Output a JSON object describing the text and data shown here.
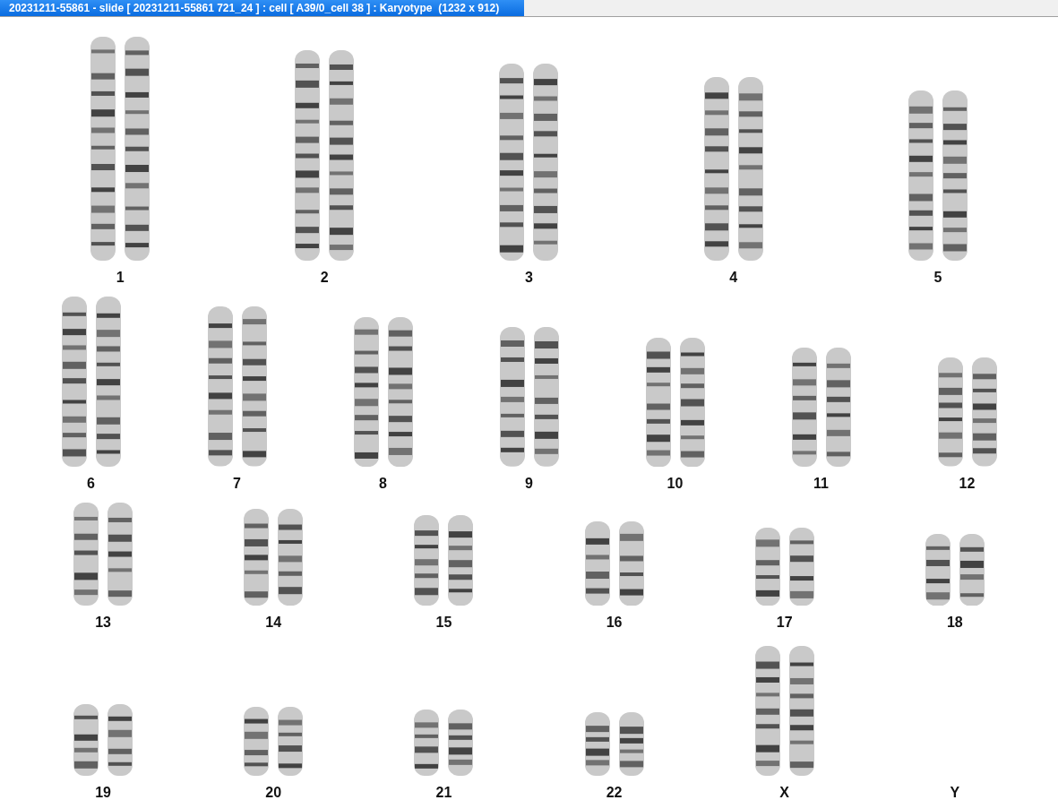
{
  "window": {
    "title": "20231211-55861 - slide [ 20231211-55861 721_24 ] : cell [ A39/0_cell 38 ] : Karyotype  (1232 x 912)"
  },
  "karyotype": {
    "rows": [
      {
        "groups": [
          {
            "label": "1",
            "kind": "pair"
          },
          {
            "label": "2",
            "kind": "pair"
          },
          {
            "label": "3",
            "kind": "pair"
          },
          {
            "label": "4",
            "kind": "pair"
          },
          {
            "label": "5",
            "kind": "pair"
          }
        ]
      },
      {
        "groups": [
          {
            "label": "6",
            "kind": "pair"
          },
          {
            "label": "7",
            "kind": "pair"
          },
          {
            "label": "8",
            "kind": "pair"
          },
          {
            "label": "9",
            "kind": "pair"
          },
          {
            "label": "10",
            "kind": "pair"
          },
          {
            "label": "11",
            "kind": "pair"
          },
          {
            "label": "12",
            "kind": "pair"
          }
        ]
      },
      {
        "groups": [
          {
            "label": "13",
            "kind": "pair"
          },
          {
            "label": "14",
            "kind": "pair"
          },
          {
            "label": "15",
            "kind": "pair"
          },
          {
            "label": "16",
            "kind": "pair"
          },
          {
            "label": "17",
            "kind": "pair"
          },
          {
            "label": "18",
            "kind": "pair"
          }
        ]
      },
      {
        "groups": [
          {
            "label": "19",
            "kind": "pair"
          },
          {
            "label": "20",
            "kind": "pair"
          },
          {
            "label": "21",
            "kind": "pair"
          },
          {
            "label": "22",
            "kind": "pair"
          },
          {
            "label": "X",
            "kind": "pair"
          },
          {
            "label": "Y",
            "kind": "empty"
          }
        ]
      }
    ]
  }
}
